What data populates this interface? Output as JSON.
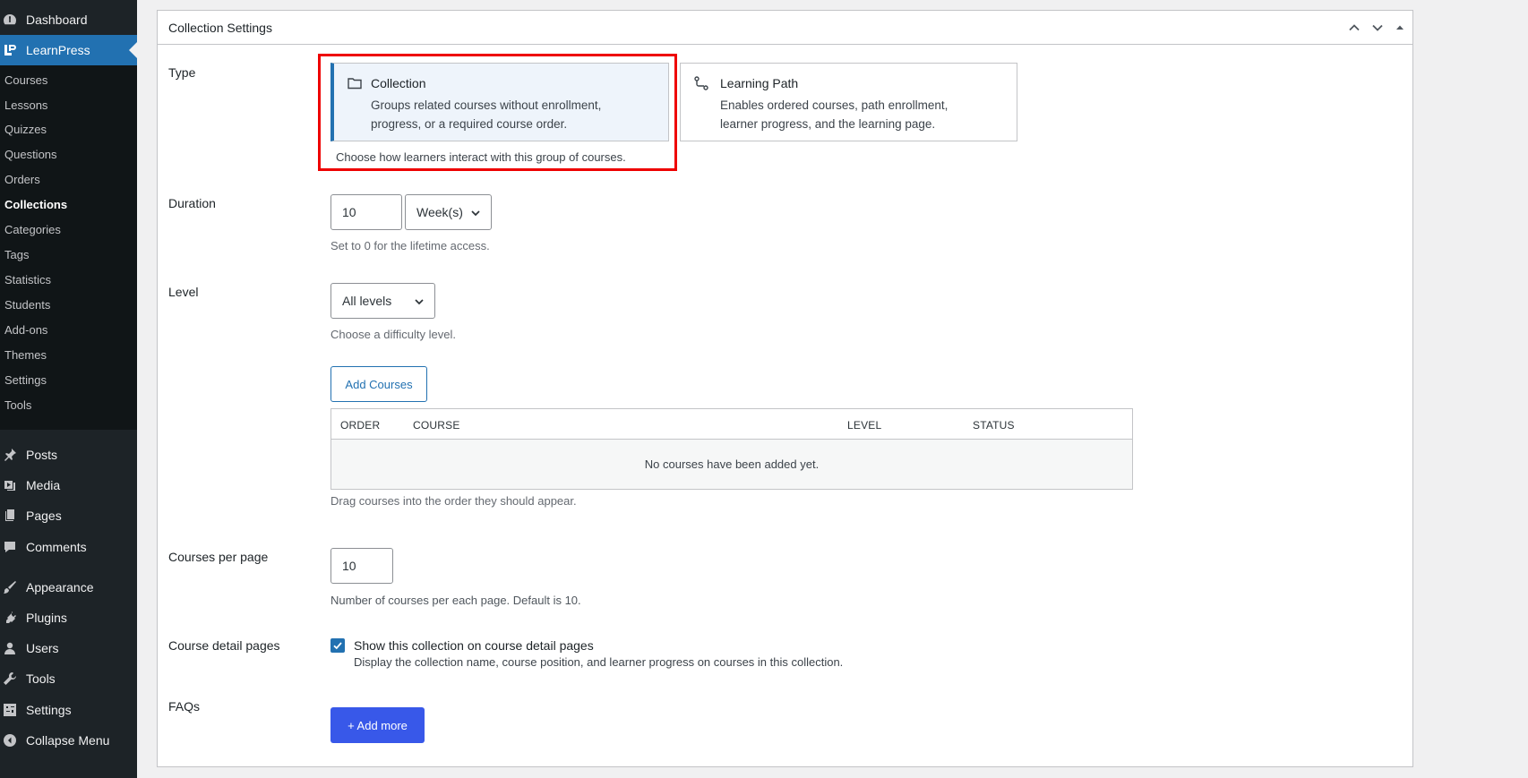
{
  "sidebar": {
    "top_items": [
      {
        "label": "Dashboard",
        "icon": "dashboard-icon"
      },
      {
        "label": "LearnPress",
        "icon": "learnpress-icon"
      }
    ],
    "sub_items": [
      "Courses",
      "Lessons",
      "Quizzes",
      "Questions",
      "Orders",
      "Collections",
      "Categories",
      "Tags",
      "Statistics",
      "Students",
      "Add-ons",
      "Themes",
      "Settings",
      "Tools"
    ],
    "bottom_items": [
      {
        "label": "Posts",
        "icon": "pin-icon"
      },
      {
        "label": "Media",
        "icon": "media-icon"
      },
      {
        "label": "Pages",
        "icon": "pages-icon"
      },
      {
        "label": "Comments",
        "icon": "comment-icon"
      },
      {
        "label": "Appearance",
        "icon": "brush-icon"
      },
      {
        "label": "Plugins",
        "icon": "plug-icon"
      },
      {
        "label": "Users",
        "icon": "user-icon"
      },
      {
        "label": "Tools",
        "icon": "wrench-icon"
      },
      {
        "label": "Settings",
        "icon": "settings-icon"
      },
      {
        "label": "Collapse Menu",
        "icon": "collapse-icon"
      }
    ],
    "current_sub": "Collections"
  },
  "panel": {
    "title": "Collection Settings",
    "type": {
      "label": "Type",
      "options": [
        {
          "title": "Collection",
          "desc": "Groups related courses without enrollment, progress, or a required course order.",
          "icon": "folder-icon",
          "selected": true
        },
        {
          "title": "Learning Path",
          "desc": "Enables ordered courses, path enrollment, learner progress, and the learning page.",
          "icon": "path-icon",
          "selected": false
        }
      ],
      "help": "Choose how learners interact with this group of courses."
    },
    "duration": {
      "label": "Duration",
      "value": "10",
      "unit": "Week(s)",
      "help": "Set to 0 for the lifetime access."
    },
    "level": {
      "label": "Level",
      "value": "All levels",
      "help": "Choose a difficulty level."
    },
    "courses": {
      "add_label": "Add Courses",
      "columns": [
        "ORDER",
        "COURSE",
        "LEVEL",
        "STATUS"
      ],
      "empty": "No courses have been added yet.",
      "help": "Drag courses into the order they should appear."
    },
    "per_page": {
      "label": "Courses per page",
      "value": "10",
      "help": "Number of courses per each page. Default is 10."
    },
    "detail_pages": {
      "label": "Course detail pages",
      "checkbox_label": "Show this collection on course detail pages",
      "checked": true,
      "help": "Display the collection name, course position, and learner progress on courses in this collection."
    },
    "faqs": {
      "label": "FAQs",
      "add_label": "+ Add more"
    }
  },
  "colors": {
    "accent": "#2271b1",
    "sidebar": "#1d2327",
    "button_primary": "#3858e9",
    "highlight": "#ee0000"
  }
}
